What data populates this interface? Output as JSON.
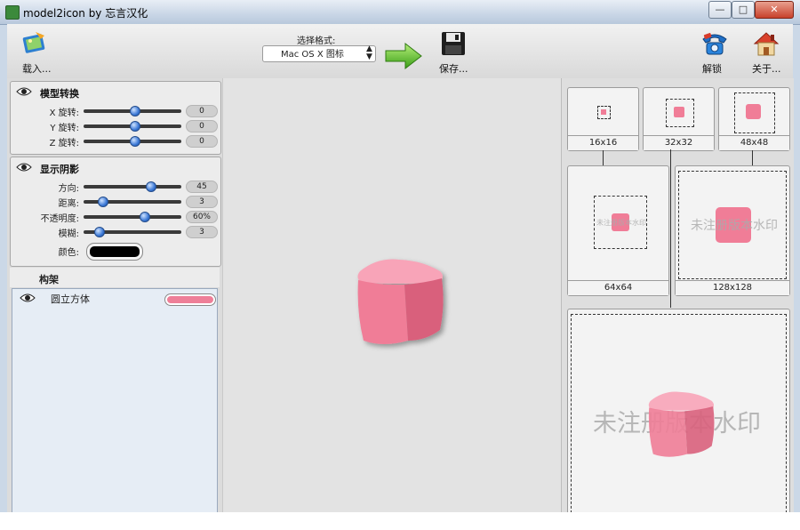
{
  "window": {
    "title": "model2icon by 忘言汉化",
    "controls": {
      "minimize": "—",
      "maximize": "□",
      "close": "✕"
    }
  },
  "toolbar": {
    "open_label": "载入...",
    "format_caption": "选择格式:",
    "format_value": "Mac OS X 图标",
    "save_label": "保存...",
    "unlock_label": "解锁",
    "about_label": "关于..."
  },
  "model_rotation": {
    "title": "模型转换",
    "rows": [
      {
        "label": "X 旋转:",
        "value": "0",
        "level": 0.5
      },
      {
        "label": "Y 旋转:",
        "value": "0",
        "level": 0.5
      },
      {
        "label": "Z 旋转:",
        "value": "0",
        "level": 0.5
      }
    ]
  },
  "shadow": {
    "title": "显示阴影",
    "rows": [
      {
        "label": "方向:",
        "value": "45",
        "level": 0.67
      },
      {
        "label": "距离:",
        "value": "3",
        "level": 0.17
      },
      {
        "label": "不透明度:",
        "value": "60%",
        "level": 0.6
      },
      {
        "label": "模糊:",
        "value": "3",
        "level": 0.13
      }
    ],
    "color_label": "颜色:",
    "color_value": "#000000"
  },
  "frame": {
    "title": "构架",
    "items": [
      {
        "label": "圆立方体",
        "color": "#ee7f98"
      }
    ]
  },
  "cube_color": "#f07d97",
  "previews": [
    {
      "label": "16x16"
    },
    {
      "label": "32x32"
    },
    {
      "label": "48x48"
    },
    {
      "label": "64x64"
    },
    {
      "label": "128x128"
    },
    {
      "label": ""
    }
  ],
  "watermark_text": "未注册版本水印"
}
